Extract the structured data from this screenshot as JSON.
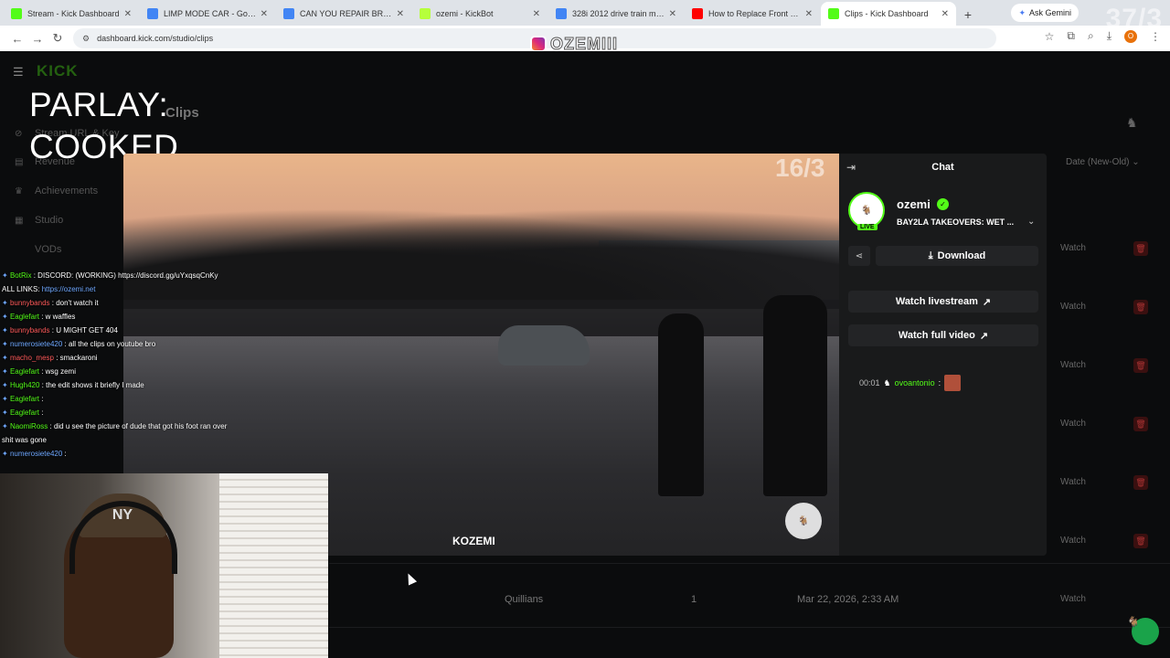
{
  "browser": {
    "tabs": [
      {
        "title": "Stream - Kick Dashboard",
        "icon": "kick-icon",
        "color": "#53fc18",
        "active": false
      },
      {
        "title": "LIMP MODE CAR - Google Se",
        "icon": "google-icon",
        "color": "#4285f4",
        "active": false
      },
      {
        "title": "CAN YOU REPAIR BRAKE PAD",
        "icon": "google-icon",
        "color": "#4285f4",
        "active": false
      },
      {
        "title": "ozemi - KickBot",
        "icon": "kickbot-icon",
        "color": "#b6ff3b",
        "active": false
      },
      {
        "title": "328i 2012 drive train malfun",
        "icon": "google-icon",
        "color": "#4285f4",
        "active": false
      },
      {
        "title": "How to Replace Front Brake",
        "icon": "youtube-icon",
        "color": "#ff0000",
        "active": false
      },
      {
        "title": "Clips - Kick Dashboard",
        "icon": "kick-icon",
        "color": "#53fc18",
        "active": true
      }
    ],
    "ask_gemini": "Ask Gemini",
    "url": "dashboard.kick.com/studio/clips",
    "profile_initial": "O"
  },
  "overlay": {
    "instagram_handle": "OZEMIII",
    "parlay_line1": "PARLAY:",
    "parlay_line2": "COOKED",
    "top_counter": "37/3",
    "chat": [
      {
        "user": "BotRix",
        "color": "#53fc18",
        "text": " : DISCORD: (WORKING) https://discord.gg/uYxqsqCnKy"
      },
      {
        "user": "",
        "color": "#fff",
        "text": "ALL LINKS: ",
        "link": "https://ozemi.net"
      },
      {
        "user": "bunnybands",
        "color": "#ff5a5a",
        "text": " : don't watch it"
      },
      {
        "user": "Eaglefart",
        "color": "#53fc18",
        "text": " : w waffles"
      },
      {
        "user": "bunnybands",
        "color": "#ff5a5a",
        "text": " : U MIGHT GET 404"
      },
      {
        "user": "numerosiete420",
        "color": "#6fa8ff",
        "text": " : all the clips on youtube bro"
      },
      {
        "user": "macho_mesp",
        "color": "#ff5a5a",
        "text": " : smackaroni"
      },
      {
        "user": "Eaglefart",
        "color": "#53fc18",
        "text": " : wsg zemi"
      },
      {
        "user": "Hugh420",
        "color": "#53fc18",
        "text": " : the edit shows it briefly I made"
      },
      {
        "user": "Eaglefart",
        "color": "#53fc18",
        "text": " : "
      },
      {
        "user": "Eaglefart",
        "color": "#53fc18",
        "text": " : "
      },
      {
        "user": "NaomiRoss",
        "color": "#53fc18",
        "text": " : did u see the picture of dude that got his foot ran over"
      },
      {
        "user": "",
        "color": "#fff",
        "text": "shit was gone"
      },
      {
        "user": "numerosiete420",
        "color": "#6fa8ff",
        "text": " : "
      }
    ]
  },
  "dashboard": {
    "logo": "KICK",
    "sidebar": [
      {
        "label": "Stream URL & Key",
        "icon": "link-icon"
      },
      {
        "label": "Revenue",
        "icon": "revenue-icon"
      },
      {
        "label": "Achievements",
        "icon": "trophy-icon"
      },
      {
        "label": "Studio",
        "icon": "studio-icon"
      },
      {
        "label": "VODs",
        "icon": "vod-icon"
      }
    ],
    "page_title": "Clips",
    "sort_label": "Date (New-Old)",
    "watch_label": "Watch",
    "last_row": {
      "name": "Quillians",
      "count": "1",
      "date": "Mar 22, 2026, 2:33 AM"
    }
  },
  "modal": {
    "video_counter": "16/3",
    "video_watermark": "KOZEMI",
    "chat_title": "Chat",
    "channel_name": "ozemi",
    "live_label": "LIVE",
    "stream_title": "BAY2LA TAKEOVERS: WET ...",
    "download_label": "Download",
    "watch_livestream_label": "Watch livestream",
    "watch_full_video_label": "Watch full video",
    "chat_message": {
      "time": "00:01",
      "user": "ovoantonio",
      "text": ":"
    }
  }
}
